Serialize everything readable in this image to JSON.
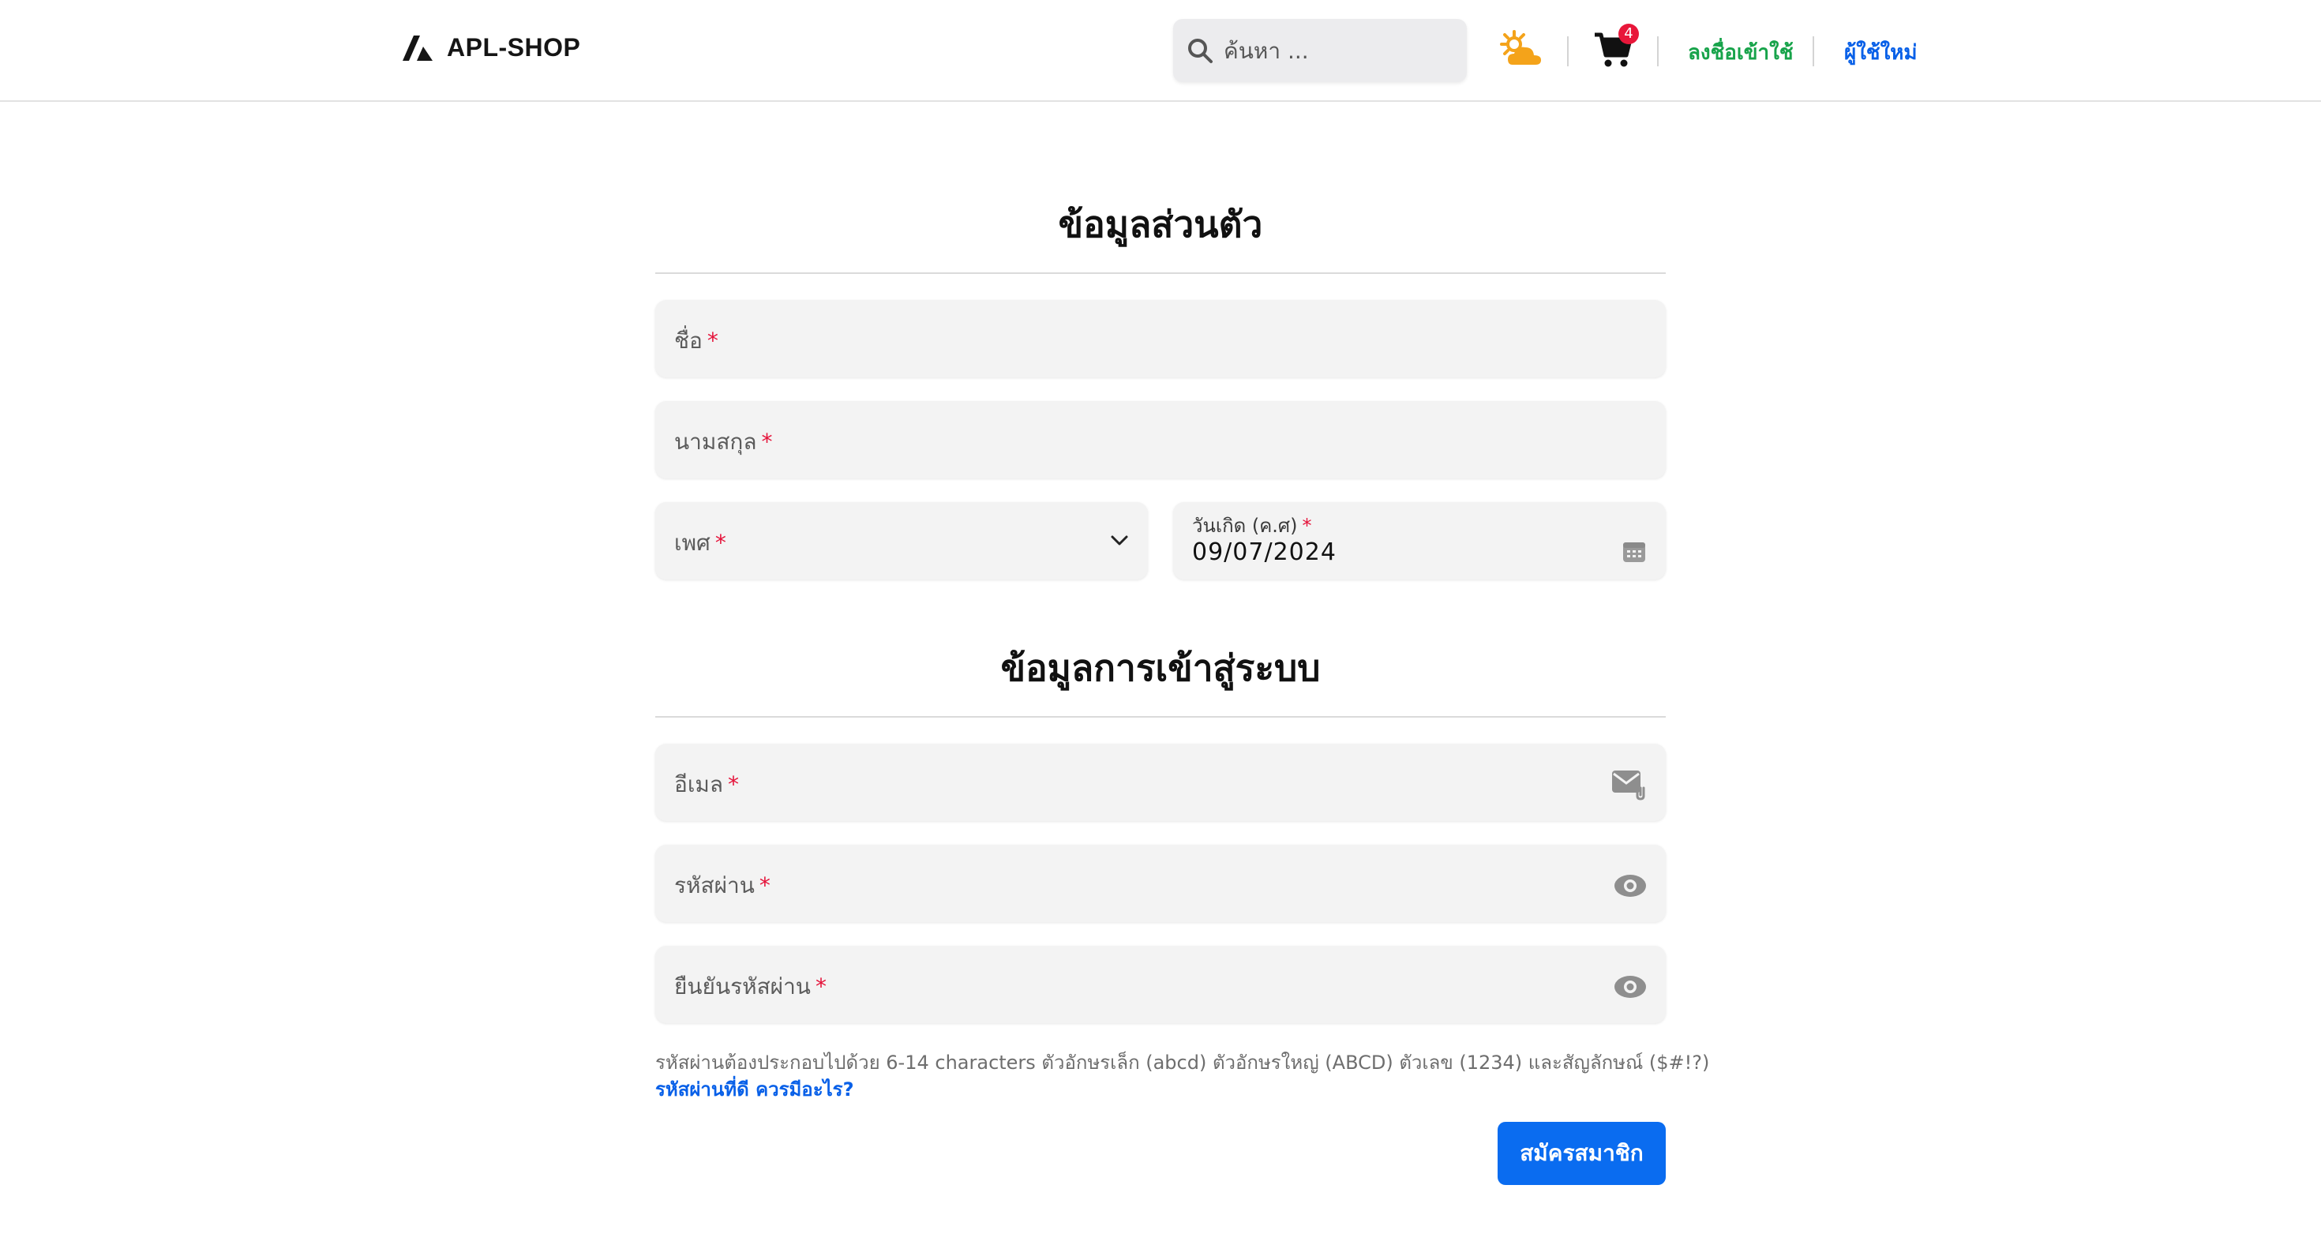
{
  "header": {
    "logo_text": "APL-SHOP",
    "search_placeholder": "ค้นหา ...",
    "cart_count": "4",
    "login_label": "ลงชื่อเข้าใช้",
    "register_label": "ผู้ใช้ใหม่"
  },
  "personal": {
    "title": "ข้อมูลส่วนตัว",
    "first_name_label": "ชื่อ",
    "last_name_label": "นามสกุล",
    "gender_label": "เพศ",
    "birthdate_label": "วันเกิด (ค.ศ)",
    "birthdate_value": "09/07/2024"
  },
  "login": {
    "title": "ข้อมูลการเข้าสู่ระบบ",
    "email_label": "อีเมล",
    "password_label": "รหัสผ่าน",
    "confirm_password_label": "ยืนยันรหัสผ่าน",
    "password_hint": "รหัสผ่านต้องประกอบไปด้วย 6-14 characters ตัวอักษรเล็ก (abcd) ตัวอักษรใหญ่ (ABCD) ตัวเลข (1234) และสัญลักษณ์ ($#!?)",
    "password_help_link": "รหัสผ่านที่ดี ควรมีอะไร?",
    "submit_label": "สมัครสมาชิก"
  },
  "required_mark": "*",
  "icons": {
    "logo": "apl-logo-icon",
    "search": "search-icon",
    "weather": "sun-cloud-icon",
    "cart": "cart-icon",
    "gender_dropdown": "chevron-down-icon",
    "calendar": "calendar-icon",
    "email": "mail-icon",
    "password_toggle": "eye-icon"
  },
  "colors": {
    "login_link": "#17a34a",
    "register_link": "#0860e8",
    "submit_bg": "#0a6cf0",
    "required": "#e5133a",
    "badge": "#e8173a"
  }
}
